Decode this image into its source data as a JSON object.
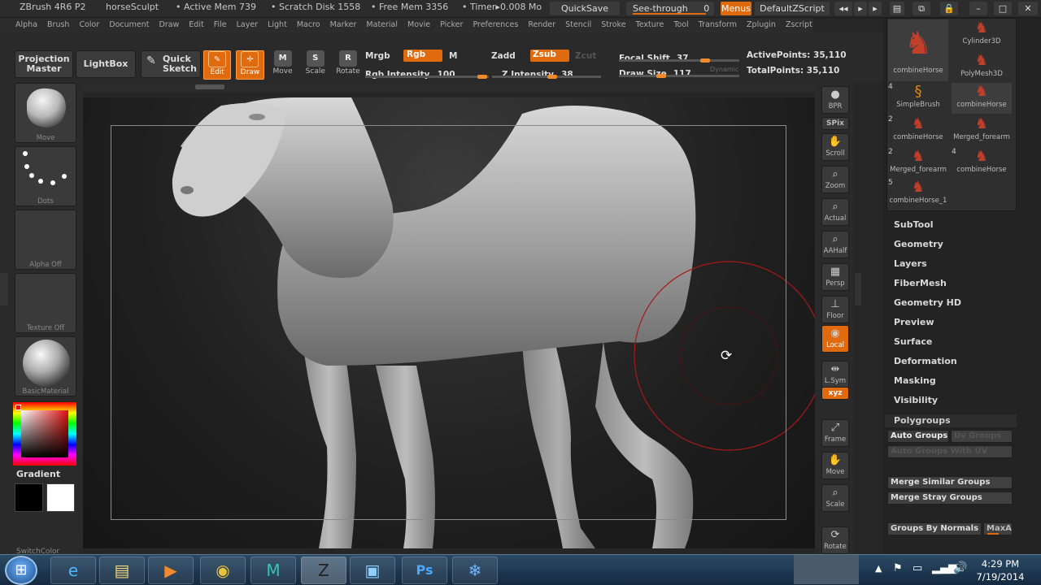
{
  "window": {
    "app": "ZBrush 4R6 P2",
    "doc": "horseSculpt",
    "active_mem": "• Active Mem 739",
    "scratch": "• Scratch Disk 1558",
    "free_mem": "• Free Mem 3356",
    "timer": "• Timer▸0.008 Mo",
    "quicksave": "QuickSave",
    "seethrough": "See-through",
    "seethrough_val": "0",
    "menus": "Menus",
    "zscript": "DefaultZScript"
  },
  "menu": [
    "Alpha",
    "Brush",
    "Color",
    "Document",
    "Draw",
    "Edit",
    "File",
    "Layer",
    "Light",
    "Macro",
    "Marker",
    "Material",
    "Movie",
    "Picker",
    "Preferences",
    "Render",
    "Stencil",
    "Stroke",
    "Texture",
    "Tool",
    "Transform",
    "Zplugin",
    "Zscript"
  ],
  "toolbar": {
    "projection": "Projection Master",
    "lightbox": "LightBox",
    "quick_sketch": "Quick Sketch",
    "tools": [
      {
        "label": "Edit",
        "glyph": "✎",
        "on": true
      },
      {
        "label": "Draw",
        "glyph": "✛",
        "on": true
      },
      {
        "label": "Move",
        "glyph": "M",
        "on": false
      },
      {
        "label": "Scale",
        "glyph": "S",
        "on": false
      },
      {
        "label": "Rotate",
        "glyph": "R",
        "on": false
      }
    ],
    "mrgb": "Mrgb",
    "rgb": "Rgb",
    "m": "M",
    "rgb_int_label": "Rgb Intensity",
    "rgb_int": "100",
    "zadd": "Zadd",
    "zsub": "Zsub",
    "zcut": "Zcut",
    "z_int_label": "Z Intensity",
    "z_int": "38",
    "focal_label": "Focal Shift",
    "focal": "37",
    "draw_label": "Draw Size",
    "draw": "117",
    "dynamic": "Dynamic",
    "active_points": "ActivePoints: 35,110",
    "total_points": "TotalPoints: 35,110"
  },
  "left": {
    "brush": "Move",
    "stroke": "Dots",
    "alpha": "Alpha Off",
    "texture": "Texture Off",
    "material": "BasicMaterial",
    "gradient": "Gradient",
    "switch": "SwitchColor"
  },
  "right_tools": [
    {
      "label": "BPR",
      "glyph": "●"
    },
    {
      "label": "SPix",
      "glyph": ""
    },
    {
      "label": "Scroll",
      "glyph": "✋"
    },
    {
      "label": "Zoom",
      "glyph": "⌕"
    },
    {
      "label": "Actual",
      "glyph": "⌕"
    },
    {
      "label": "AAHalf",
      "glyph": "⌕"
    },
    {
      "label": "Persp",
      "glyph": "▦"
    },
    {
      "label": "Floor",
      "glyph": "⊥"
    },
    {
      "label": "Local",
      "glyph": "◉"
    },
    {
      "label": "L.Sym",
      "glyph": "⇹"
    },
    {
      "label": "xyz",
      "glyph": "⟳"
    },
    {
      "label": "Frame",
      "glyph": "⤢"
    },
    {
      "label": "Move",
      "glyph": "✋"
    },
    {
      "label": "Scale",
      "glyph": "⌕"
    },
    {
      "label": "Rotate",
      "glyph": "⟳"
    }
  ],
  "tray": {
    "subtools": [
      {
        "label": "combineHorse",
        "n": ""
      },
      {
        "label": "Cylinder3D",
        "n": ""
      },
      {
        "label": "PolyMesh3D",
        "n": ""
      },
      {
        "label": "SimpleBrush",
        "n": "4"
      },
      {
        "label": "combineHorse",
        "n": ""
      },
      {
        "label": "combineHorse",
        "n": "2"
      },
      {
        "label": "Merged_forearm",
        "n": ""
      },
      {
        "label": "Merged_forearm",
        "n": "2"
      },
      {
        "label": "combineHorse",
        "n": "4"
      },
      {
        "label": "combineHorse_1",
        "n": "5"
      }
    ],
    "palettes": [
      "SubTool",
      "Geometry",
      "Layers",
      "FiberMesh",
      "Geometry HD",
      "Preview",
      "Surface",
      "Deformation",
      "Masking",
      "Visibility"
    ],
    "polygroups": "Polygroups",
    "auto_groups": "Auto Groups",
    "uv_groups": "Uv Groups",
    "auto_groups_uv": "Auto Groups With UV",
    "merge_similar": "Merge Similar Groups",
    "merge_stray": "Merge Stray Groups",
    "groups_by_normals": "Groups By Normals",
    "maxangle": "MaxAr"
  },
  "taskbar": {
    "time": "4:29 PM",
    "date": "7/19/2014"
  }
}
